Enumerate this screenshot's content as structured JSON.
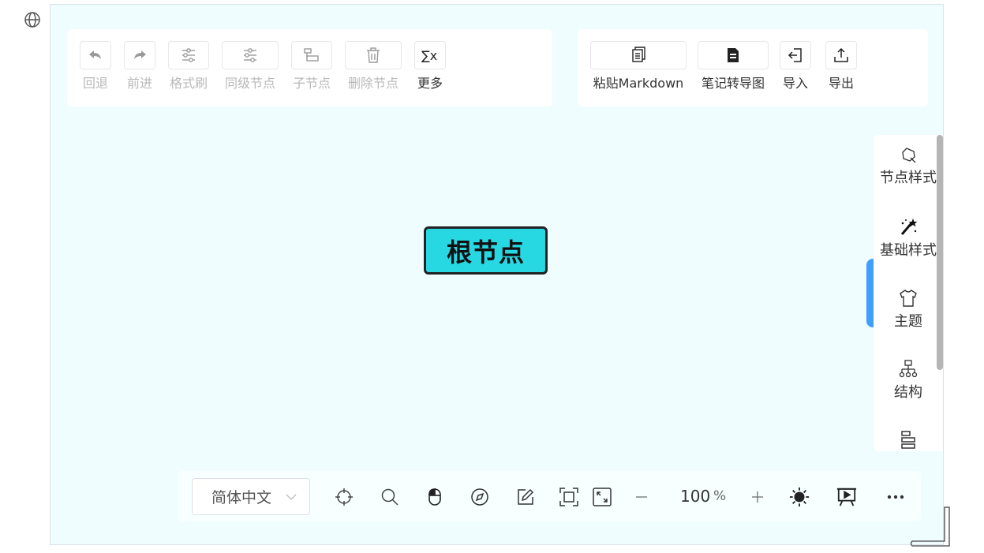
{
  "toolbar_left": [
    {
      "label": "回退",
      "icon": "undo-icon",
      "disabled": true
    },
    {
      "label": "前进",
      "icon": "redo-icon",
      "disabled": true
    },
    {
      "label": "格式刷",
      "icon": "format-painter-icon",
      "disabled": true
    },
    {
      "label": "同级节点",
      "icon": "sibling-node-icon",
      "disabled": true
    },
    {
      "label": "子节点",
      "icon": "child-node-icon",
      "disabled": true
    },
    {
      "label": "删除节点",
      "icon": "trash-icon",
      "disabled": true
    },
    {
      "label": "更多",
      "icon": "formula-icon",
      "disabled": false
    }
  ],
  "toolbar_right": [
    {
      "label": "粘贴Markdown",
      "icon": "paste-markdown-icon"
    },
    {
      "label": "笔记转导图",
      "icon": "note-icon"
    },
    {
      "label": "导入",
      "icon": "import-icon"
    },
    {
      "label": "导出",
      "icon": "export-icon"
    }
  ],
  "root_node": {
    "text": "根节点",
    "fill": "#27d8e3"
  },
  "sidebar": [
    {
      "label": "节点样式",
      "icon": "node-style-icon"
    },
    {
      "label": "基础样式",
      "icon": "magic-wand-icon"
    },
    {
      "label": "主题",
      "icon": "shirt-icon"
    },
    {
      "label": "结构",
      "icon": "structure-icon"
    },
    {
      "label": "",
      "icon": "outline-icon"
    }
  ],
  "bottom": {
    "language": "简体中文",
    "zoom_value": "100",
    "zoom_unit": "%",
    "icons": [
      "locate-icon",
      "search-icon",
      "mouse-icon",
      "compass-icon",
      "edit-icon",
      "fit-icon",
      "fullscreen-icon",
      "zoom-out-icon",
      "zoom-in-icon",
      "dark-mode-icon",
      "presentation-icon",
      "more-icon"
    ]
  },
  "colors": {
    "canvas_bg": "#effdff",
    "accent": "#409eff"
  }
}
